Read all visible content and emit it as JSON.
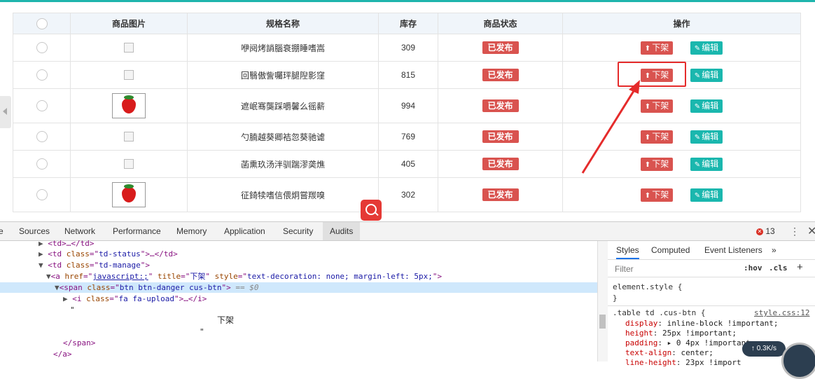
{
  "table": {
    "headers": [
      "商品图片",
      "规格名称",
      "库存",
      "商品状态",
      "操作"
    ],
    "rows": [
      {
        "image": "broken",
        "name": "咿阋烤誚腦衰掤睡嗜嵩",
        "stock": "309",
        "status": "已发布",
        "down": "下架",
        "edit": "编辑"
      },
      {
        "image": "broken",
        "name": "回翳傲訾囑玶腿隉影窪",
        "stock": "815",
        "status": "已发布",
        "down": "下架",
        "edit": "编辑"
      },
      {
        "image": "strawberry",
        "name": "遮岷骞龑踩嚼馨么徭薪",
        "stock": "994",
        "status": "已发布",
        "down": "下架",
        "edit": "编辑"
      },
      {
        "image": "broken",
        "name": "勺腩越葵卿袺忽葵驰谑",
        "stock": "769",
        "status": "已发布",
        "down": "下架",
        "edit": "编辑"
      },
      {
        "image": "broken",
        "name": "菡熏玖汤泮驯踹漻䶮燋",
        "stock": "405",
        "status": "已发布",
        "down": "下架",
        "edit": "编辑"
      },
      {
        "image": "strawberry",
        "name": "征錡犊嗜信偎炯嘗羰嗅",
        "stock": "302",
        "status": "已发布",
        "down": "下架",
        "edit": "编辑"
      }
    ]
  },
  "devtools": {
    "tabs": [
      "e",
      "Sources",
      "Network",
      "Performance",
      "Memory",
      "Application",
      "Security",
      "Audits"
    ],
    "active_tab": "Audits",
    "error_count": "13",
    "code": {
      "l1": "<td>…</td>",
      "l2a": "<td ",
      "l2b": "class",
      "l2c": "=\"",
      "l2d": "td-status",
      "l2e": "\">…</td>",
      "l3a": "<td ",
      "l3b": "class",
      "l3c": "=\"",
      "l3d": "td-manage",
      "l3e": "\">",
      "l4a": "<a ",
      "l4b": "href",
      "l4c": "=\"",
      "l4d": "javascript:;",
      "l4e": "\" ",
      "l4f": "title",
      "l4g": "=\"",
      "l4h": "下架",
      "l4i": "\" ",
      "l4j": "style",
      "l4k": "=\"",
      "l4l": "text-decoration: none; margin-left: 5px;",
      "l4m": "\">",
      "l5a": "<span ",
      "l5b": "class",
      "l5c": "=\"",
      "l5d": "btn btn-danger cus-btn",
      "l5e": "\">",
      "l5f": " == $0",
      "l6a": "<i ",
      "l6b": "class",
      "l6c": "=\"",
      "l6d": "fa fa-upload",
      "l6e": "\">…</i>",
      "l7": "\"",
      "l8": "下架",
      "l9": "\"",
      "l10": "</span>",
      "l11": "</a>"
    },
    "styles": {
      "tabs": [
        "Styles",
        "Computed",
        "Event Listeners",
        "»"
      ],
      "filter_placeholder": "Filter",
      "hov": ":hov",
      "cls": ".cls",
      "plus": "+",
      "element_style": "element.style {",
      "close_brace": "}",
      "rule_selector": ".table td .cus-btn {",
      "rule_source": "style.css:12",
      "props": [
        {
          "name": "display",
          "value": "inline-block !important;"
        },
        {
          "name": "height",
          "value": "25px !important;"
        },
        {
          "name": "padding",
          "value": "▸ 0 4px !important;"
        },
        {
          "name": "text-align",
          "value": "center;"
        },
        {
          "name": "line-height",
          "value": "23px !import"
        }
      ]
    },
    "net_speed": "↑ 0.3K/s"
  }
}
